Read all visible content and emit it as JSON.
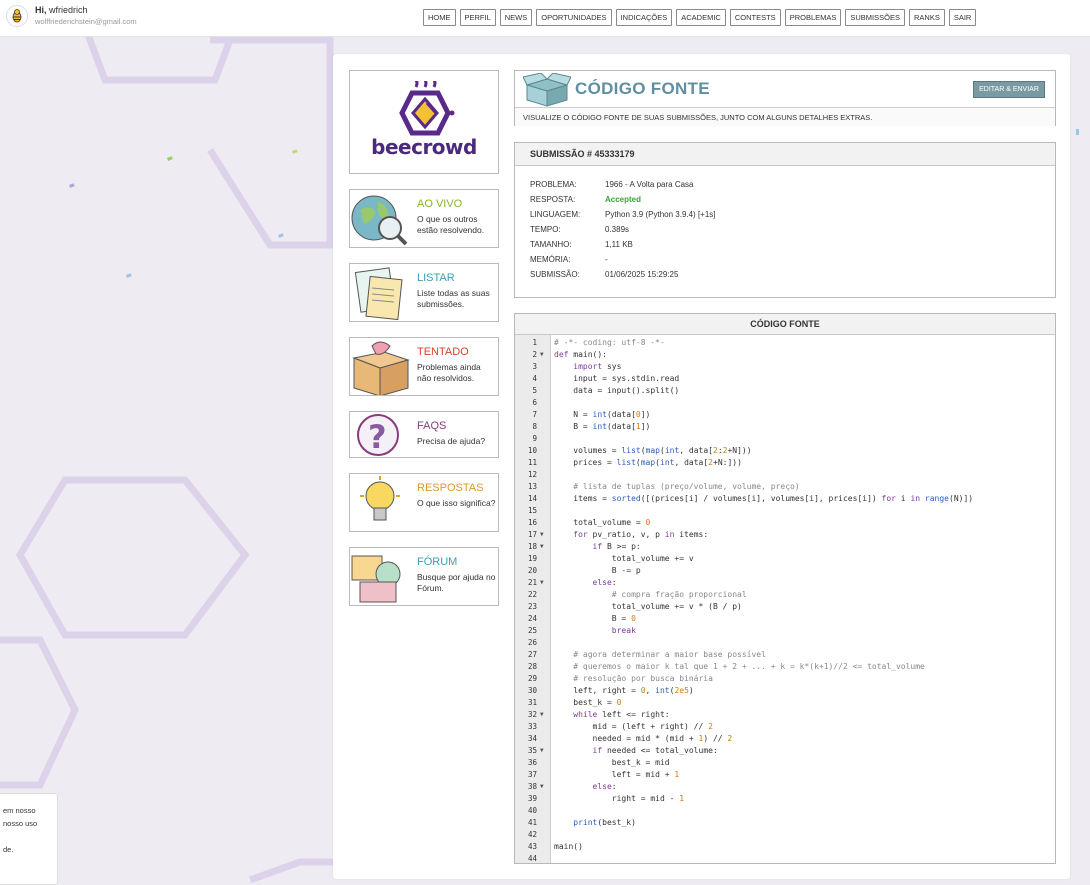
{
  "user": {
    "greeting": "Hi,",
    "name": "wfriedrich",
    "email": "wolffriederichstein@gmail.com"
  },
  "nav": [
    {
      "label": "HOME",
      "w": 32
    },
    {
      "label": "PERFIL",
      "w": 38,
      "dot": ""
    },
    {
      "label": "NEWS",
      "w": 32,
      "dot": "9"
    },
    {
      "label": "OPORTUNIDADES",
      "w": 76
    },
    {
      "label": "INDICAÇÕES",
      "w": 56
    },
    {
      "label": "ACADEMIC",
      "w": 52
    },
    {
      "label": "CONTESTS",
      "w": 50
    },
    {
      "label": "PROBLEMAS",
      "w": 56
    },
    {
      "label": "SUBMISSÕES",
      "w": 57
    },
    {
      "label": "RANKS",
      "w": 36
    },
    {
      "label": "SAIR",
      "w": 28
    }
  ],
  "logo": "beecrowd",
  "side": [
    {
      "title": "AO VIVO",
      "desc": "O que os outros estão resolvendo.",
      "color": "#8ab42a",
      "icon": "globe-icon"
    },
    {
      "title": "LISTAR",
      "desc": "Liste todas as suas submissões.",
      "color": "#3b9cb5",
      "icon": "documents-icon"
    },
    {
      "title": "TENTADO",
      "desc": "Problemas ainda não resolvidos.",
      "color": "#d8432e",
      "icon": "box-icon"
    },
    {
      "title": "FAQS",
      "desc": "Precisa de ajuda?",
      "color": "#8a3a7a",
      "icon": "question-icon"
    },
    {
      "title": "RESPOSTAS",
      "desc": "O que isso significa?",
      "color": "#e0962a",
      "icon": "lightbulb-icon"
    },
    {
      "title": "FÓRUM",
      "desc": "Busque por ajuda no Fórum.",
      "color": "#3b9cb5",
      "icon": "forum-icon"
    }
  ],
  "page": {
    "title": "CÓDIGO FONTE",
    "edit": "EDITAR & ENVIAR",
    "subtitle": "VISUALIZE O CÓDIGO FONTE DE SUAS SUBMISSÕES, JUNTO COM ALGUNS DETALHES EXTRAS."
  },
  "submission": {
    "header": "SUBMISSÃO # 45333179",
    "rows": [
      {
        "label": "PROBLEMA:",
        "value": "1966 - A Volta para Casa"
      },
      {
        "label": "RESPOSTA:",
        "value": "Accepted",
        "accent": "#3aa53a"
      },
      {
        "label": "LINGUAGEM:",
        "value": "Python 3.9 (Python 3.9.4) [+1s]"
      },
      {
        "label": "TEMPO:",
        "value": "0.389s"
      },
      {
        "label": "TAMANHO:",
        "value": "1,11 KB"
      },
      {
        "label": "MEMÓRIA:",
        "value": "-"
      },
      {
        "label": "SUBMISSÃO:",
        "value": "01/06/2025 15:29:25"
      }
    ]
  },
  "code": {
    "header": "CÓDIGO FONTE",
    "lines": [
      "# -*- coding: utf-8 -*-",
      "def main():",
      "    import sys",
      "    input = sys.stdin.read",
      "    data = input().split()",
      "",
      "    N = int(data[0])",
      "    B = int(data[1])",
      "",
      "    volumes = list(map(int, data[2:2+N]))",
      "    prices = list(map(int, data[2+N:]))",
      "",
      "    # lista de tuplas (preço/volume, volume, preço)",
      "    items = sorted([(prices[i] / volumes[i], volumes[i], prices[i]) for i in range(N)])",
      "",
      "    total_volume = 0",
      "    for pv_ratio, v, p in items:",
      "        if B >= p:",
      "            total_volume += v",
      "            B -= p",
      "        else:",
      "            # compra fração proporcional",
      "            total_volume += v * (B / p)",
      "            B = 0",
      "            break",
      "",
      "    # agora determinar a maior base possível",
      "    # queremos o maior k tal que 1 + 2 + ... + k = k*(k+1)//2 <= total_volume",
      "    # resolução por busca binária",
      "    left, right = 0, int(2e5)",
      "    best_k = 0",
      "    while left <= right:",
      "        mid = (left + right) // 2",
      "        needed = mid * (mid + 1) // 2",
      "        if needed <= total_volume:",
      "            best_k = mid",
      "            left = mid + 1",
      "        else:",
      "            right = mid - 1",
      "",
      "    print(best_k)",
      "",
      "main()",
      ""
    ],
    "folds": [
      2,
      17,
      18,
      21,
      32,
      35,
      38
    ]
  },
  "cookie": {
    "line1": "em nosso",
    "line2": "nosso uso",
    "line3": "de."
  },
  "colors": {
    "accent": "#5f8fa0",
    "accepted": "#3aa53a",
    "keyword": "#7a3a9a",
    "number": "#d07a1a",
    "comment": "#888888",
    "builtin": "#2a5cb8"
  }
}
